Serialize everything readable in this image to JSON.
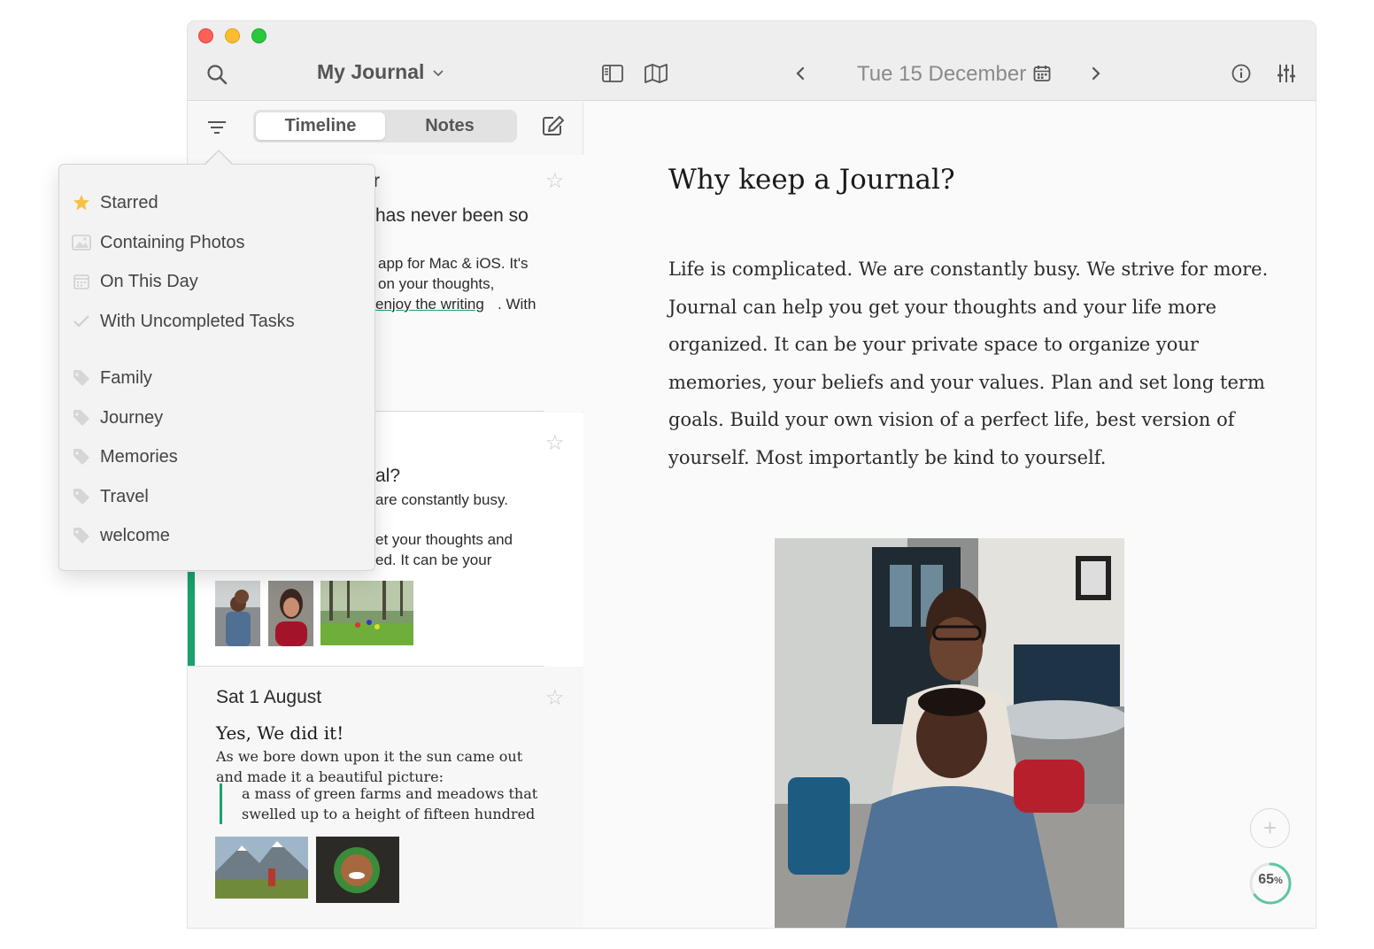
{
  "toolbar": {
    "journal_title": "My Journal",
    "date": "Tue 15 December",
    "icons": [
      "search-icon",
      "sidebar-icon",
      "map-icon",
      "chevron-left-icon",
      "calendar-icon",
      "chevron-right-icon",
      "info-icon",
      "sliders-icon"
    ]
  },
  "sidebar": {
    "tabs": [
      {
        "label": "Timeline",
        "active": true
      },
      {
        "label": "Notes",
        "active": false
      }
    ]
  },
  "filter_menu": {
    "items": [
      {
        "label": "Starred",
        "icon": "star-icon"
      },
      {
        "label": "Containing Photos",
        "icon": "photo-icon"
      },
      {
        "label": "On This Day",
        "icon": "calendar-icon"
      },
      {
        "label": "With Uncompleted Tasks",
        "icon": "check-icon"
      }
    ],
    "tags": [
      "Family",
      "Journey",
      "Memories",
      "Travel",
      "welcome"
    ]
  },
  "entries": [
    {
      "fragments": [
        "r",
        "has never been so",
        "app for Mac & iOS. It's",
        "on your thoughts,",
        "enjoy the writing",
        ". With"
      ]
    },
    {
      "fragments": [
        "al?",
        "are constantly busy.",
        "et your thoughts and",
        "ed.  It can be your"
      ]
    },
    {
      "date": "Sat 1 August",
      "title": "Yes, We did it!",
      "body": "As we bore down upon it the sun came out and made it a beautiful picture:",
      "quote": "a mass of green farms and meadows that swelled up to a height of fifteen hundred"
    }
  ],
  "document": {
    "title": "Why keep a Journal?",
    "body": "Life is complicated. We are constantly busy.  We strive for more. Journal can help you get your thoughts and your life more organized.  It can be your private space to organize your memories, your beliefs and your values. Plan and set long term goals.  Build your own vision of a perfect life, best version of yourself. Most importantly be kind to yourself."
  },
  "progress": {
    "value": "65",
    "unit": "%",
    "fraction": 0.65
  },
  "colors": {
    "accent": "#1aa16c",
    "star": "#f5c242"
  }
}
